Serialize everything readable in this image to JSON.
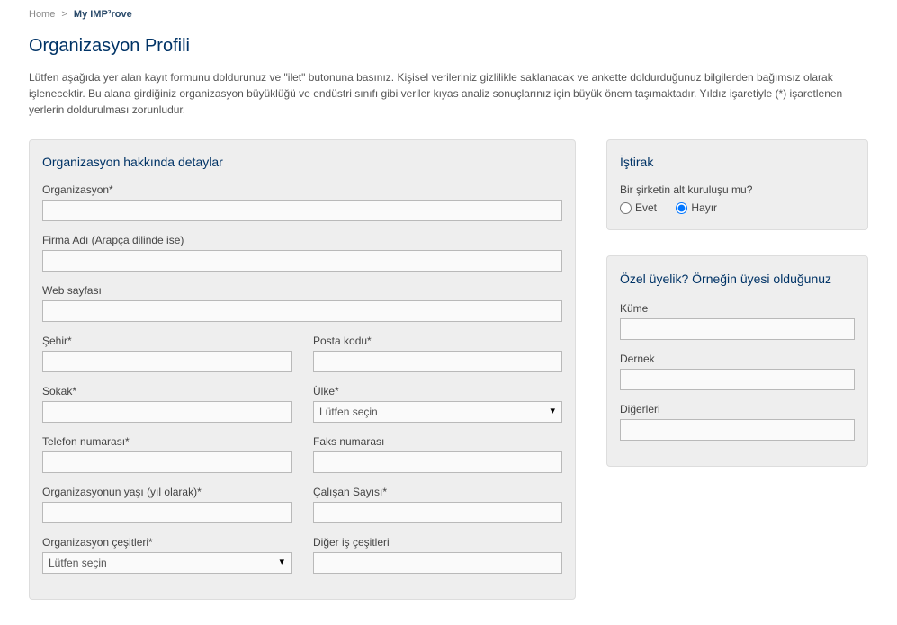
{
  "breadcrumb": {
    "home": "Home",
    "sep": ">",
    "current": "My IMP³rove"
  },
  "title": "Organizasyon Profili",
  "intro": "Lütfen aşağıda yer alan kayıt formunu doldurunuz ve \"ilet\" butonuna basınız. Kişisel verileriniz gizlilikle saklanacak ve ankette doldurduğunuz bilgilerden bağımsız olarak işlenecektir. Bu alana girdiğiniz organizasyon büyüklüğü ve endüstri sınıfı gibi veriler kıyas analiz sonuçlarınız için büyük önem taşımaktadır. Yıldız işaretiyle (*) işaretlenen yerlerin doldurulması zorunludur.",
  "left": {
    "heading": "Organizasyon hakkında detaylar",
    "organization": "Organizasyon*",
    "company_ar": "Firma Adı (Arapça dilinde ise)",
    "website": "Web sayfası",
    "city": "Şehir*",
    "postal": "Posta kodu*",
    "street": "Sokak*",
    "country": "Ülke*",
    "country_placeholder": "Lütfen seçin",
    "phone": "Telefon numarası*",
    "fax": "Faks numarası",
    "age": "Organizasyonun yaşı (yıl olarak)*",
    "employees": "Çalışan Sayısı*",
    "orgtype": "Organizasyon çeşitleri*",
    "orgtype_placeholder": "Lütfen seçin",
    "other_biz": "Diğer iş çeşitleri"
  },
  "right": {
    "affil_heading": "İştirak",
    "affil_question": "Bir şirketin alt kuruluşu mu?",
    "yes": "Evet",
    "no": "Hayır",
    "membership_heading": "Özel üyelik? Örneğin üyesi olduğunuz",
    "cluster": "Küme",
    "association": "Dernek",
    "others": "Diğerleri"
  }
}
